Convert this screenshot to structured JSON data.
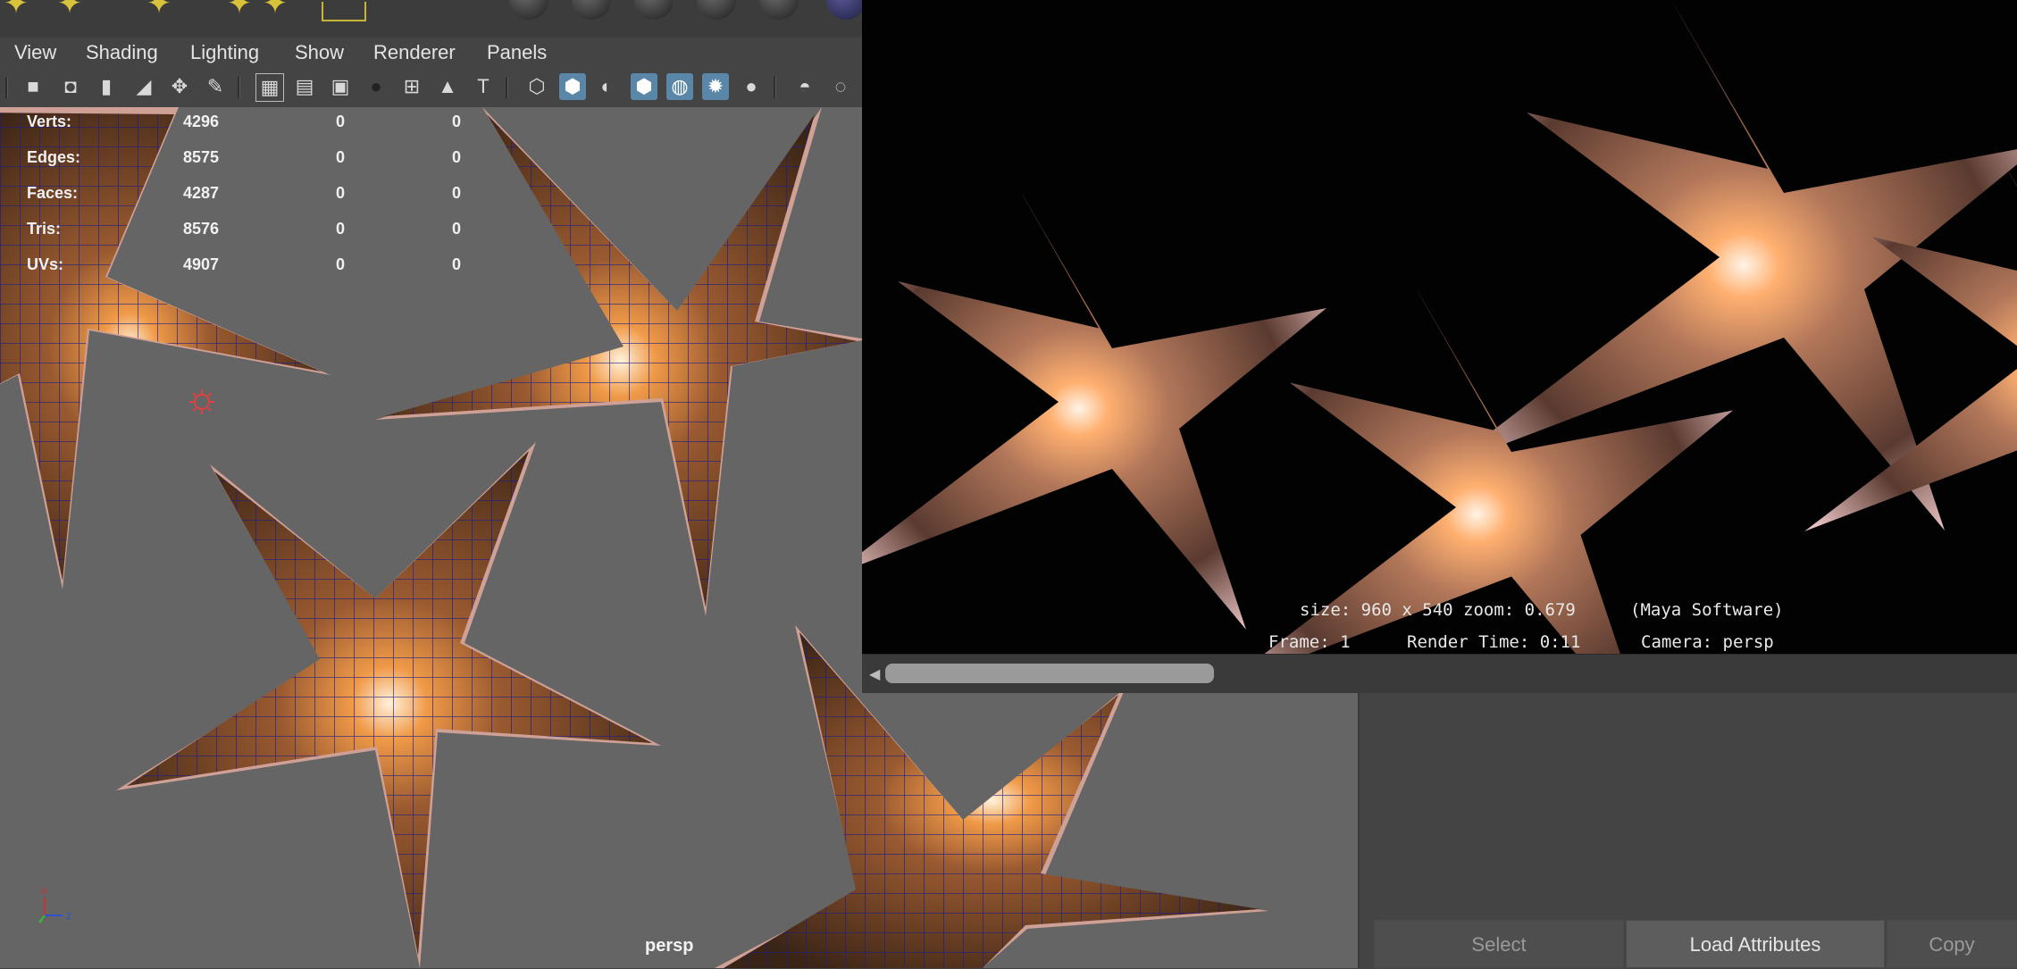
{
  "viewport_menu": [
    "View",
    "Shading",
    "Lighting",
    "Show",
    "Renderer",
    "Panels"
  ],
  "toolbar_icons": [
    "camera-icon",
    "camera-attributes-icon",
    "bookmark-icon",
    "image-plane-icon",
    "2d-pan-zoom-icon",
    "grease-pencil-icon",
    "grid-icon",
    "film-gate-icon",
    "resolution-gate-icon",
    "gate-mask-icon",
    "field-chart-icon",
    "safe-action-icon",
    "safe-title-icon",
    "wireframe-icon",
    "smooth-shade-icon",
    "wireframe-on-shaded-icon",
    "xray-icon",
    "xray-joints-icon",
    "textured-icon",
    "lighting-icon",
    "shadows-icon",
    "ambient-occlusion-icon",
    "motion-blur-icon"
  ],
  "hud": {
    "rows": [
      {
        "label": "Verts:",
        "v1": "4296",
        "v2": "0",
        "v3": "0"
      },
      {
        "label": "Edges:",
        "v1": "8575",
        "v2": "0",
        "v3": "0"
      },
      {
        "label": "Faces:",
        "v1": "4287",
        "v2": "0",
        "v3": "0"
      },
      {
        "label": "Tris:",
        "v1": "8576",
        "v2": "0",
        "v3": "0"
      },
      {
        "label": "UVs:",
        "v1": "4907",
        "v2": "0",
        "v3": "0"
      }
    ]
  },
  "viewport": {
    "camera_label": "persp"
  },
  "render_view": {
    "size_line": "size: 960 x 540 zoom: 0.679",
    "renderer": "(Maya Software)",
    "frame": "Frame: 1",
    "render_time": "Render Time: 0:11",
    "camera": "Camera: persp"
  },
  "attribute_buttons": {
    "select": "Select",
    "load": "Load Attributes",
    "copy": "Copy"
  },
  "colors": {
    "viewport_bg": "#656565",
    "wire": "#1a1d8a",
    "starfish_body": "#7a4a2a",
    "spot": "#e7b04a",
    "center": "#ff8a2a",
    "highlight": "#5a86a8"
  }
}
